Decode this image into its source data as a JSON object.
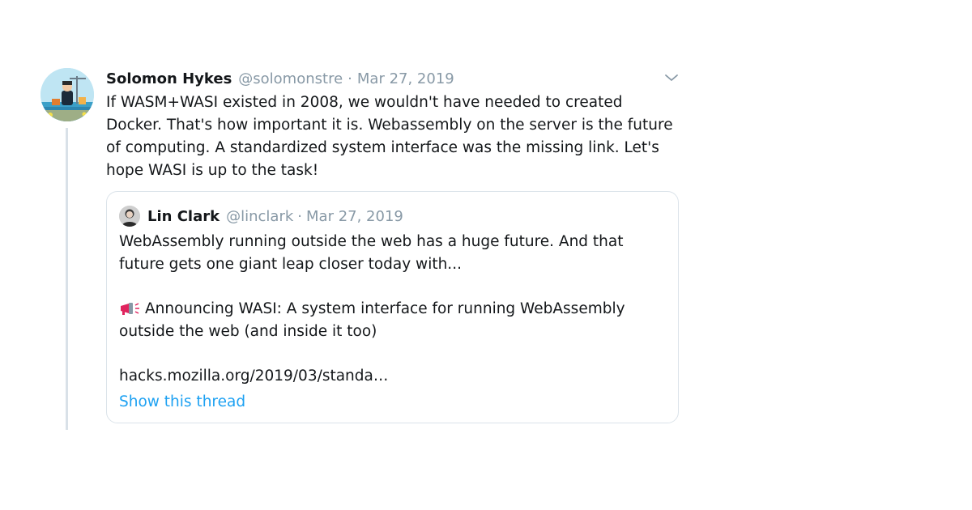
{
  "tweet": {
    "author_name": "Solomon Hykes",
    "author_handle": "@solomonstre",
    "separator": "·",
    "date": "Mar 27, 2019",
    "text_lines": [
      "If WASM+WASI existed in 2008, we wouldn't have needed to created",
      "Docker. That's how important it is. Webassembly on the server is the future",
      "of computing. A standardized system interface was the missing link. Let's",
      "hope WASI is up to the task!"
    ],
    "menu_icon": "chevron-down-icon",
    "avatar_icon": "avatar-illustration"
  },
  "quoted": {
    "author_name": "Lin Clark",
    "author_handle": "@linclark",
    "separator": "·",
    "date": "Mar 27, 2019",
    "lines": [
      "WebAssembly running outside the web has a huge future. And that",
      "future gets one giant leap closer today with...",
      "Announcing WASI: A system interface for running WebAssembly",
      "outside the web (and inside it too)",
      "hacks.mozilla.org/2019/03/standa…"
    ],
    "megaphone_icon": "megaphone-icon",
    "show_thread": "Show this thread",
    "link_color": "#1da1f2"
  },
  "colors": {
    "text": "#14171a",
    "muted": "#8899a6",
    "border": "#dbe3ea",
    "thread_line": "#d9e1e8"
  }
}
